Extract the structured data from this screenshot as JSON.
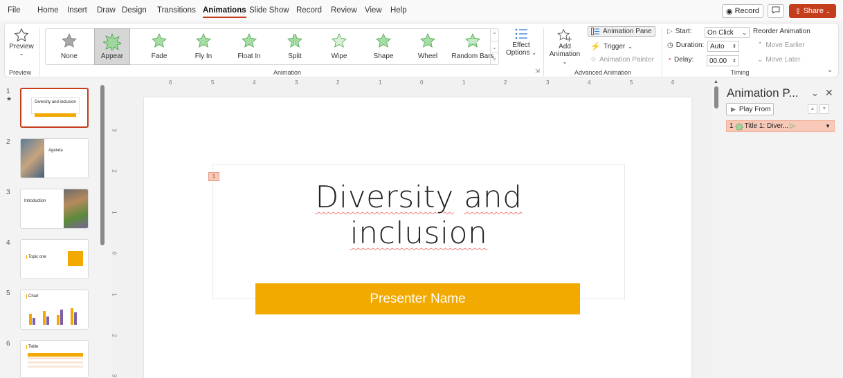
{
  "menu": {
    "items": [
      "File",
      "Home",
      "Insert",
      "Draw",
      "Design",
      "Transitions",
      "Animations",
      "Slide Show",
      "Record",
      "Review",
      "View",
      "Help"
    ],
    "active": "Animations",
    "record_label": "Record",
    "share_label": "Share"
  },
  "ribbon": {
    "preview_label": "Preview",
    "preview_group": "Preview",
    "animation_group": "Animation",
    "advanced_group": "Advanced Animation",
    "timing_group": "Timing",
    "animations": [
      "None",
      "Appear",
      "Fade",
      "Fly In",
      "Float In",
      "Split",
      "Wipe",
      "Shape",
      "Wheel",
      "Random Bars"
    ],
    "selected_animation": "Appear",
    "effect_options_line1": "Effect",
    "effect_options_line2": "Options",
    "add_animation_line1": "Add",
    "add_animation_line2": "Animation",
    "animation_pane_label": "Animation Pane",
    "trigger_label": "Trigger",
    "animation_painter_label": "Animation Painter",
    "start_label": "Start:",
    "start_value": "On Click",
    "duration_label": "Duration:",
    "duration_value": "Auto",
    "delay_label": "Delay:",
    "delay_value": "00.00",
    "reorder_label": "Reorder Animation",
    "move_earlier_label": "Move Earlier",
    "move_later_label": "Move Later"
  },
  "thumbnails": [
    {
      "number": "1",
      "title": "Diversity and inclusion"
    },
    {
      "number": "2",
      "title": "Agenda"
    },
    {
      "number": "3",
      "title": "Introduction"
    },
    {
      "number": "4",
      "title": "Topic one"
    },
    {
      "number": "5",
      "title": "Chart"
    },
    {
      "number": "6",
      "title": "Table"
    }
  ],
  "ruler_h": [
    "6",
    "5",
    "4",
    "3",
    "2",
    "1",
    "0",
    "1",
    "2",
    "3",
    "4",
    "5",
    "6"
  ],
  "ruler_v": [
    "3",
    "2",
    "1",
    "0",
    "1",
    "2",
    "3"
  ],
  "slide": {
    "title_line1_a": "Diversity",
    "title_line1_b": "and",
    "title_line2": "inclusion",
    "presenter": "Presenter Name",
    "animation_tag": "1"
  },
  "anim_pane": {
    "title": "Animation P...",
    "play_from_label": "Play From",
    "item_number": "1",
    "item_label": "Title 1: Diver..."
  },
  "colors": {
    "accent": "#c43e1c",
    "presenter_bar": "#f2a900",
    "anim_star": "#5cb85c"
  }
}
